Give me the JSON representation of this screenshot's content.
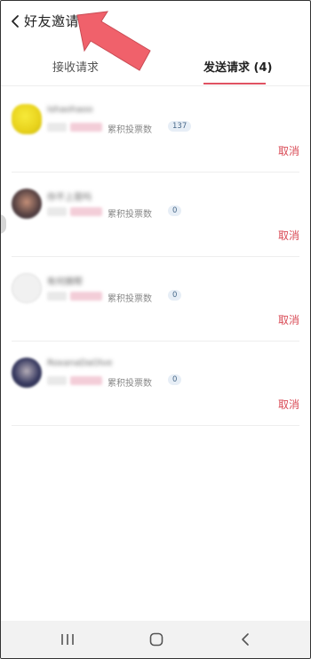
{
  "header": {
    "title": "好友邀请",
    "back_icon": "chevron-left-icon"
  },
  "tabs": [
    {
      "label": "接收请求",
      "active": false
    },
    {
      "label": "发送请求 (4)",
      "active": true
    }
  ],
  "requests": [
    {
      "name": "Ishaohaoo",
      "tag_a": "未名",
      "tag_b": "未发表",
      "votes_label": "累积投票数",
      "votes": "137",
      "cancel": "取消"
    },
    {
      "name": "你不上是吗",
      "tag_a": "未名",
      "tag_b": "未发表",
      "votes_label": "累积投票数",
      "votes": "0",
      "cancel": "取消"
    },
    {
      "name": "有何摘帮",
      "tag_a": "未名",
      "tag_b": "未发表",
      "votes_label": "累积投票数",
      "votes": "0",
      "cancel": "取消"
    },
    {
      "name": "RoxanaDaOlve",
      "tag_a": "未名",
      "tag_b": "未发表",
      "votes_label": "累积投票数",
      "votes": "0",
      "cancel": "取消"
    }
  ],
  "colors": {
    "accent": "#e05262",
    "cancel": "#d94a55",
    "arrow": "#f0616b"
  },
  "navbar": {
    "icons": [
      "recent-apps-icon",
      "home-icon",
      "back-icon"
    ]
  }
}
